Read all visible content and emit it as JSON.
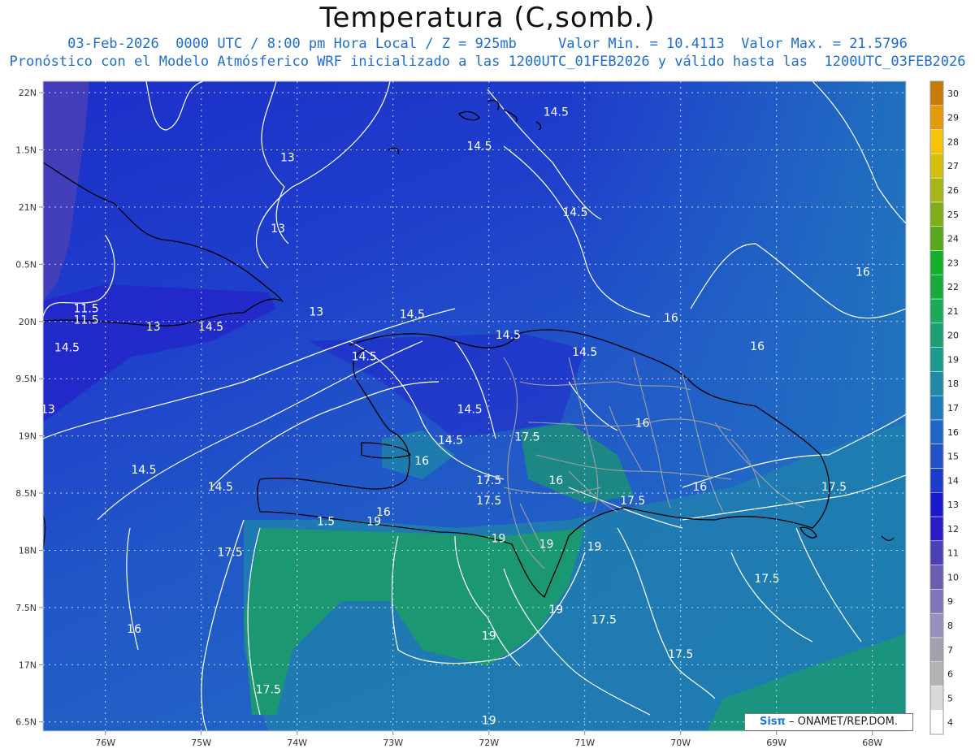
{
  "title": "Temperatura (C,somb.)",
  "subtitle_line1": "03-Feb-2026  0000 UTC / 8:00 pm Hora Local / Z = 925mb     Valor Min. = 10.4113  Valor Max. = 21.5796",
  "subtitle_line2": "Pronóstico con el Modelo Atmósferico WRF inicializado a las 1200UTC_01FEB2026 y válido hasta las  1200UTC_03FEB2026",
  "credit": {
    "logo": "Sisπ",
    "text": "– ONAMET/REP.DOM."
  },
  "lat_labels": [
    "22N",
    "1.5N",
    "21N",
    "0.5N",
    "20N",
    "9.5N",
    "19N",
    "8.5N",
    "18N",
    "7.5N",
    "17N",
    "6.5N"
  ],
  "lon_labels": [
    "76W",
    "75W",
    "74W",
    "73W",
    "72W",
    "71W",
    "70W",
    "69W",
    "68W"
  ],
  "colorbar": {
    "labels": [
      "4",
      "5",
      "6",
      "7",
      "8",
      "9",
      "10",
      "11",
      "12",
      "13",
      "14",
      "15",
      "16",
      "17",
      "18",
      "19",
      "20",
      "21",
      "22",
      "23",
      "24",
      "25",
      "26",
      "27",
      "28",
      "29",
      "30"
    ],
    "colors": [
      "#ffffff",
      "#d9d9d9",
      "#b3b3b3",
      "#a1a1af",
      "#9b8fbf",
      "#8276b8",
      "#6a5eb0",
      "#4b40b5",
      "#2a1cc4",
      "#1a1aca",
      "#1d3ccb",
      "#2152c8",
      "#2166c6",
      "#1f7ab8",
      "#1e8aa4",
      "#1c9a8c",
      "#1aa072",
      "#1aaa5a",
      "#18aa3c",
      "#15b02a",
      "#5aa81e",
      "#80ae1a",
      "#a8b518",
      "#d4c00c",
      "#f4c30a",
      "#e49a08",
      "#c77b06"
    ]
  },
  "contour_labels": [
    {
      "text": "14.5",
      "lon": -71.3,
      "lat": 21.8
    },
    {
      "text": "14.5",
      "lon": -72.1,
      "lat": 21.5
    },
    {
      "text": "13",
      "lon": -74.1,
      "lat": 21.4
    },
    {
      "text": "14.5",
      "lon": -71.1,
      "lat": 20.92
    },
    {
      "text": "13",
      "lon": -74.2,
      "lat": 20.78
    },
    {
      "text": "16",
      "lon": -68.1,
      "lat": 20.4
    },
    {
      "text": "11.5",
      "lon": -76.2,
      "lat": 20.08
    },
    {
      "text": "13",
      "lon": -73.8,
      "lat": 20.05
    },
    {
      "text": "11.5",
      "lon": -76.2,
      "lat": 19.98
    },
    {
      "text": "13",
      "lon": -75.5,
      "lat": 19.92
    },
    {
      "text": "14.5",
      "lon": -74.9,
      "lat": 19.92
    },
    {
      "text": "14.5",
      "lon": -72.8,
      "lat": 20.03
    },
    {
      "text": "16",
      "lon": -70.1,
      "lat": 20.0
    },
    {
      "text": "14.5",
      "lon": -71.8,
      "lat": 19.85
    },
    {
      "text": "14.5",
      "lon": -76.4,
      "lat": 19.74
    },
    {
      "text": "16",
      "lon": -69.2,
      "lat": 19.75
    },
    {
      "text": "14.5",
      "lon": -73.3,
      "lat": 19.66
    },
    {
      "text": "14.5",
      "lon": -71.0,
      "lat": 19.7
    },
    {
      "text": "13",
      "lon": -76.6,
      "lat": 19.2
    },
    {
      "text": "14.5",
      "lon": -72.2,
      "lat": 19.2
    },
    {
      "text": "16",
      "lon": -70.4,
      "lat": 19.08
    },
    {
      "text": "17.5",
      "lon": -71.6,
      "lat": 18.96
    },
    {
      "text": "14.5",
      "lon": -72.4,
      "lat": 18.93
    },
    {
      "text": "16",
      "lon": -72.7,
      "lat": 18.75
    },
    {
      "text": "14.5",
      "lon": -75.6,
      "lat": 18.67
    },
    {
      "text": "17.5",
      "lon": -72.0,
      "lat": 18.58
    },
    {
      "text": "16",
      "lon": -71.3,
      "lat": 18.58
    },
    {
      "text": "14.5",
      "lon": -74.8,
      "lat": 18.52
    },
    {
      "text": "17.5",
      "lon": -72.0,
      "lat": 18.4
    },
    {
      "text": "17.5",
      "lon": -70.5,
      "lat": 18.4
    },
    {
      "text": "16",
      "lon": -69.8,
      "lat": 18.52
    },
    {
      "text": "17.5",
      "lon": -68.4,
      "lat": 18.52
    },
    {
      "text": "16",
      "lon": -73.1,
      "lat": 18.3
    },
    {
      "text": "1.5",
      "lon": -73.7,
      "lat": 18.22
    },
    {
      "text": "19",
      "lon": -73.2,
      "lat": 18.22
    },
    {
      "text": "19",
      "lon": -71.9,
      "lat": 18.07
    },
    {
      "text": "19",
      "lon": -71.4,
      "lat": 18.02
    },
    {
      "text": "19",
      "lon": -70.9,
      "lat": 18.0
    },
    {
      "text": "17.5",
      "lon": -74.7,
      "lat": 17.95
    },
    {
      "text": "17.5",
      "lon": -69.1,
      "lat": 17.72
    },
    {
      "text": "19",
      "lon": -71.3,
      "lat": 17.45
    },
    {
      "text": "17.5",
      "lon": -70.8,
      "lat": 17.36
    },
    {
      "text": "16",
      "lon": -75.7,
      "lat": 17.28
    },
    {
      "text": "19",
      "lon": -72.0,
      "lat": 17.22
    },
    {
      "text": "17.5",
      "lon": -70.0,
      "lat": 17.06
    },
    {
      "text": "17.5",
      "lon": -74.3,
      "lat": 16.75
    },
    {
      "text": "19",
      "lon": -72.0,
      "lat": 16.48
    }
  ]
}
